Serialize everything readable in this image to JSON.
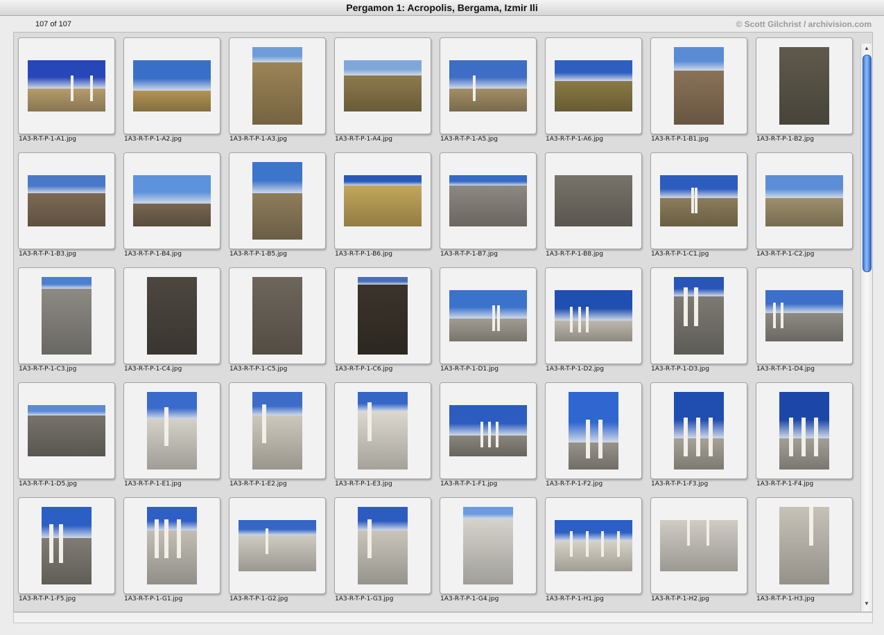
{
  "window": {
    "title": "Pergamon 1: Acropolis, Bergama, Izmir Ili"
  },
  "info": {
    "count": "107 of 107",
    "copyright": "© Scott Gilchrist / archivision.com"
  },
  "thumbnails": [
    {
      "file": "1A3-R-T-P-1-A1.jpg",
      "o": "l",
      "sky": "#2747b8",
      "ground": "#b59c6c",
      "h": 0.55,
      "cols": [
        0.55,
        0.8
      ]
    },
    {
      "file": "1A3-R-T-P-1-A2.jpg",
      "o": "l",
      "sky": "#3a6fc8",
      "ground": "#b19354",
      "h": 0.6,
      "cols": []
    },
    {
      "file": "1A3-R-T-P-1-A3.jpg",
      "o": "p",
      "sky": "#6f9dd9",
      "ground": "#9c8456",
      "h": 0.2,
      "cols": []
    },
    {
      "file": "1A3-R-T-P-1-A4.jpg",
      "o": "l",
      "sky": "#7fa8d9",
      "ground": "#8d7a4d",
      "h": 0.3,
      "cols": []
    },
    {
      "file": "1A3-R-T-P-1-A5.jpg",
      "o": "l",
      "sky": "#3d6dc5",
      "ground": "#a28e66",
      "h": 0.55,
      "cols": [
        0.3
      ]
    },
    {
      "file": "1A3-R-T-P-1-A6.jpg",
      "o": "l",
      "sky": "#2e5fc0",
      "ground": "#8a7a45",
      "h": 0.4,
      "cols": []
    },
    {
      "file": "1A3-R-T-P-1-B1.jpg",
      "o": "p",
      "sky": "#5a8cd6",
      "ground": "#8a7258",
      "h": 0.3,
      "cols": []
    },
    {
      "file": "1A3-R-T-P-1-B2.jpg",
      "o": "p",
      "sky": "#6b6658",
      "ground": "#5f5a4c",
      "h": 0.0,
      "cols": []
    },
    {
      "file": "1A3-R-T-P-1-B3.jpg",
      "o": "l",
      "sky": "#4a78c9",
      "ground": "#7d6a55",
      "h": 0.35,
      "cols": []
    },
    {
      "file": "1A3-R-T-P-1-B4.jpg",
      "o": "l",
      "sky": "#5d93dc",
      "ground": "#776651",
      "h": 0.55,
      "cols": []
    },
    {
      "file": "1A3-R-T-P-1-B5.jpg",
      "o": "p",
      "sky": "#3d74cc",
      "ground": "#8e7d5c",
      "h": 0.4,
      "cols": []
    },
    {
      "file": "1A3-R-T-P-1-B6.jpg",
      "o": "l",
      "sky": "#2a58b9",
      "ground": "#c3a65b",
      "h": 0.2,
      "cols": []
    },
    {
      "file": "1A3-R-T-P-1-B7.jpg",
      "o": "l",
      "sky": "#3569c7",
      "ground": "#8d8880",
      "h": 0.2,
      "cols": []
    },
    {
      "file": "1A3-R-T-P-1-B8.jpg",
      "o": "l",
      "sky": "#8c877a",
      "ground": "#78736a",
      "h": 0.0,
      "cols": []
    },
    {
      "file": "1A3-R-T-P-1-C1.jpg",
      "o": "l",
      "sky": "#2d5cbf",
      "ground": "#8c7d5b",
      "h": 0.45,
      "cols": [
        0.4,
        0.45
      ]
    },
    {
      "file": "1A3-R-T-P-1-C2.jpg",
      "o": "l",
      "sky": "#5b8ed6",
      "ground": "#9e8f6c",
      "h": 0.45,
      "cols": []
    },
    {
      "file": "1A3-R-T-P-1-C3.jpg",
      "o": "p",
      "sky": "#4c7fd0",
      "ground": "#8d8a84",
      "h": 0.15,
      "cols": []
    },
    {
      "file": "1A3-R-T-P-1-C4.jpg",
      "o": "p",
      "sky": "#2f2a24",
      "ground": "#4d4740",
      "h": 0.0,
      "cols": []
    },
    {
      "file": "1A3-R-T-P-1-C5.jpg",
      "o": "p",
      "sky": "#5a5349",
      "ground": "#6e665b",
      "h": 0.0,
      "cols": []
    },
    {
      "file": "1A3-R-T-P-1-C6.jpg",
      "o": "p",
      "sky": "#4a6fb8",
      "ground": "#3b342c",
      "h": 0.1,
      "cols": []
    },
    {
      "file": "1A3-R-T-P-1-D1.jpg",
      "o": "l",
      "sky": "#3b72cc",
      "ground": "#a19c92",
      "h": 0.55,
      "cols": [
        0.55,
        0.62
      ]
    },
    {
      "file": "1A3-R-T-P-1-D2.jpg",
      "o": "l",
      "sky": "#1f4fb0",
      "ground": "#bdb8ad",
      "h": 0.6,
      "cols": [
        0.2,
        0.3,
        0.4
      ]
    },
    {
      "file": "1A3-R-T-P-1-D3.jpg",
      "o": "p",
      "sky": "#2954b8",
      "ground": "#7d7a73",
      "h": 0.25,
      "cols": [
        0.2,
        0.4
      ]
    },
    {
      "file": "1A3-R-T-P-1-D4.jpg",
      "o": "l",
      "sky": "#3b6fc9",
      "ground": "#8e8b83",
      "h": 0.45,
      "cols": [
        0.1,
        0.2
      ]
    },
    {
      "file": "1A3-R-T-P-1-D5.jpg",
      "o": "l",
      "sky": "#5d8ad2",
      "ground": "#77736b",
      "h": 0.2,
      "cols": []
    },
    {
      "file": "1A3-R-T-P-1-E1.jpg",
      "o": "p",
      "sky": "#3a6acb",
      "ground": "#d4d1c8",
      "h": 0.35,
      "cols": [
        0.35
      ]
    },
    {
      "file": "1A3-R-T-P-1-E2.jpg",
      "o": "p",
      "sky": "#3c6cc8",
      "ground": "#cdc8bc",
      "h": 0.3,
      "cols": [
        0.2
      ]
    },
    {
      "file": "1A3-R-T-P-1-E3.jpg",
      "o": "p",
      "sky": "#3566c6",
      "ground": "#dcd8ce",
      "h": 0.25,
      "cols": [
        0.2
      ]
    },
    {
      "file": "1A3-R-T-P-1-F1.jpg",
      "o": "l",
      "sky": "#2c5cc0",
      "ground": "#8a867d",
      "h": 0.6,
      "cols": [
        0.4,
        0.5,
        0.6
      ]
    },
    {
      "file": "1A3-R-T-P-1-F2.jpg",
      "o": "p",
      "sky": "#2f66cf",
      "ground": "#97928a",
      "h": 0.65,
      "cols": [
        0.35,
        0.6
      ]
    },
    {
      "file": "1A3-R-T-P-1-F3.jpg",
      "o": "p",
      "sky": "#1f4db0",
      "ground": "#a6a297",
      "h": 0.6,
      "cols": [
        0.2,
        0.45,
        0.7
      ]
    },
    {
      "file": "1A3-R-T-P-1-F4.jpg",
      "o": "p",
      "sky": "#1c47a8",
      "ground": "#a29f96",
      "h": 0.6,
      "cols": [
        0.2,
        0.45,
        0.7
      ]
    },
    {
      "file": "1A3-R-T-P-1-F5.jpg",
      "o": "p",
      "sky": "#2c5fc5",
      "ground": "#807c74",
      "h": 0.4,
      "cols": [
        0.15,
        0.35
      ]
    },
    {
      "file": "1A3-R-T-P-1-G1.jpg",
      "o": "p",
      "sky": "#2e5fc4",
      "ground": "#c2beb5",
      "h": 0.3,
      "cols": [
        0.15,
        0.35,
        0.6
      ]
    },
    {
      "file": "1A3-R-T-P-1-G2.jpg",
      "o": "l",
      "sky": "#3566c4",
      "ground": "#cfcbc2",
      "h": 0.3,
      "cols": [
        0.35
      ]
    },
    {
      "file": "1A3-R-T-P-1-G3.jpg",
      "o": "p",
      "sky": "#2d5cc0",
      "ground": "#c9c5bb",
      "h": 0.3,
      "cols": [
        0.2
      ]
    },
    {
      "file": "1A3-R-T-P-1-G4.jpg",
      "o": "p",
      "sky": "#6b9be0",
      "ground": "#d6d3cc",
      "h": 0.15,
      "cols": []
    },
    {
      "file": "1A3-R-T-P-1-H1.jpg",
      "o": "l",
      "sky": "#2c5ec6",
      "ground": "#d7d2c6",
      "h": 0.4,
      "cols": [
        0.2,
        0.4,
        0.6,
        0.8
      ]
    },
    {
      "file": "1A3-R-T-P-1-H2.jpg",
      "o": "l",
      "sky": "#3f78d6",
      "ground": "#d0ccc4",
      "h": 0.0,
      "cols": [
        0.35,
        0.6
      ]
    },
    {
      "file": "1A3-R-T-P-1-H3.jpg",
      "o": "p",
      "sky": "#2b63cf",
      "ground": "#c7c2b8",
      "h": 0.0,
      "cols": [
        0.6
      ]
    }
  ]
}
